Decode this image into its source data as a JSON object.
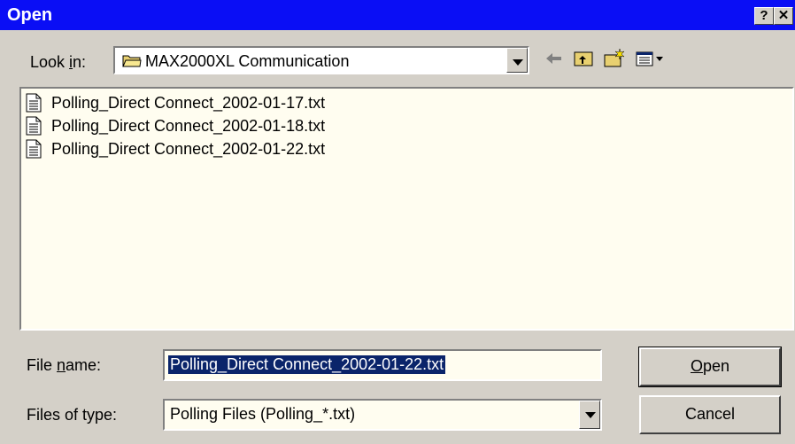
{
  "window": {
    "title": "Open",
    "help_label": "?",
    "close_label": "✕"
  },
  "look_in": {
    "label_prefix": "Look ",
    "label_accel": "i",
    "label_suffix": "n:",
    "value": "MAX2000XL Communication"
  },
  "toolbar": {
    "icons": [
      "back-icon",
      "up-folder-icon",
      "new-folder-icon",
      "view-menu-icon"
    ]
  },
  "files": [
    {
      "name": "Polling_Direct Connect_2002-01-17.txt"
    },
    {
      "name": "Polling_Direct Connect_2002-01-18.txt"
    },
    {
      "name": "Polling_Direct Connect_2002-01-22.txt"
    }
  ],
  "file_name": {
    "label_prefix": "File ",
    "label_accel": "n",
    "label_suffix": "ame:",
    "value": "Polling_Direct Connect_2002-01-22.txt"
  },
  "file_type": {
    "label": "Files of type:",
    "value": "Polling Files (Polling_*.txt)"
  },
  "buttons": {
    "open_accel": "O",
    "open_rest": "pen",
    "cancel": "Cancel"
  },
  "colors": {
    "title_bar": "#0a0ef5",
    "face": "#d4d0c8",
    "selection": "#0a246a"
  }
}
